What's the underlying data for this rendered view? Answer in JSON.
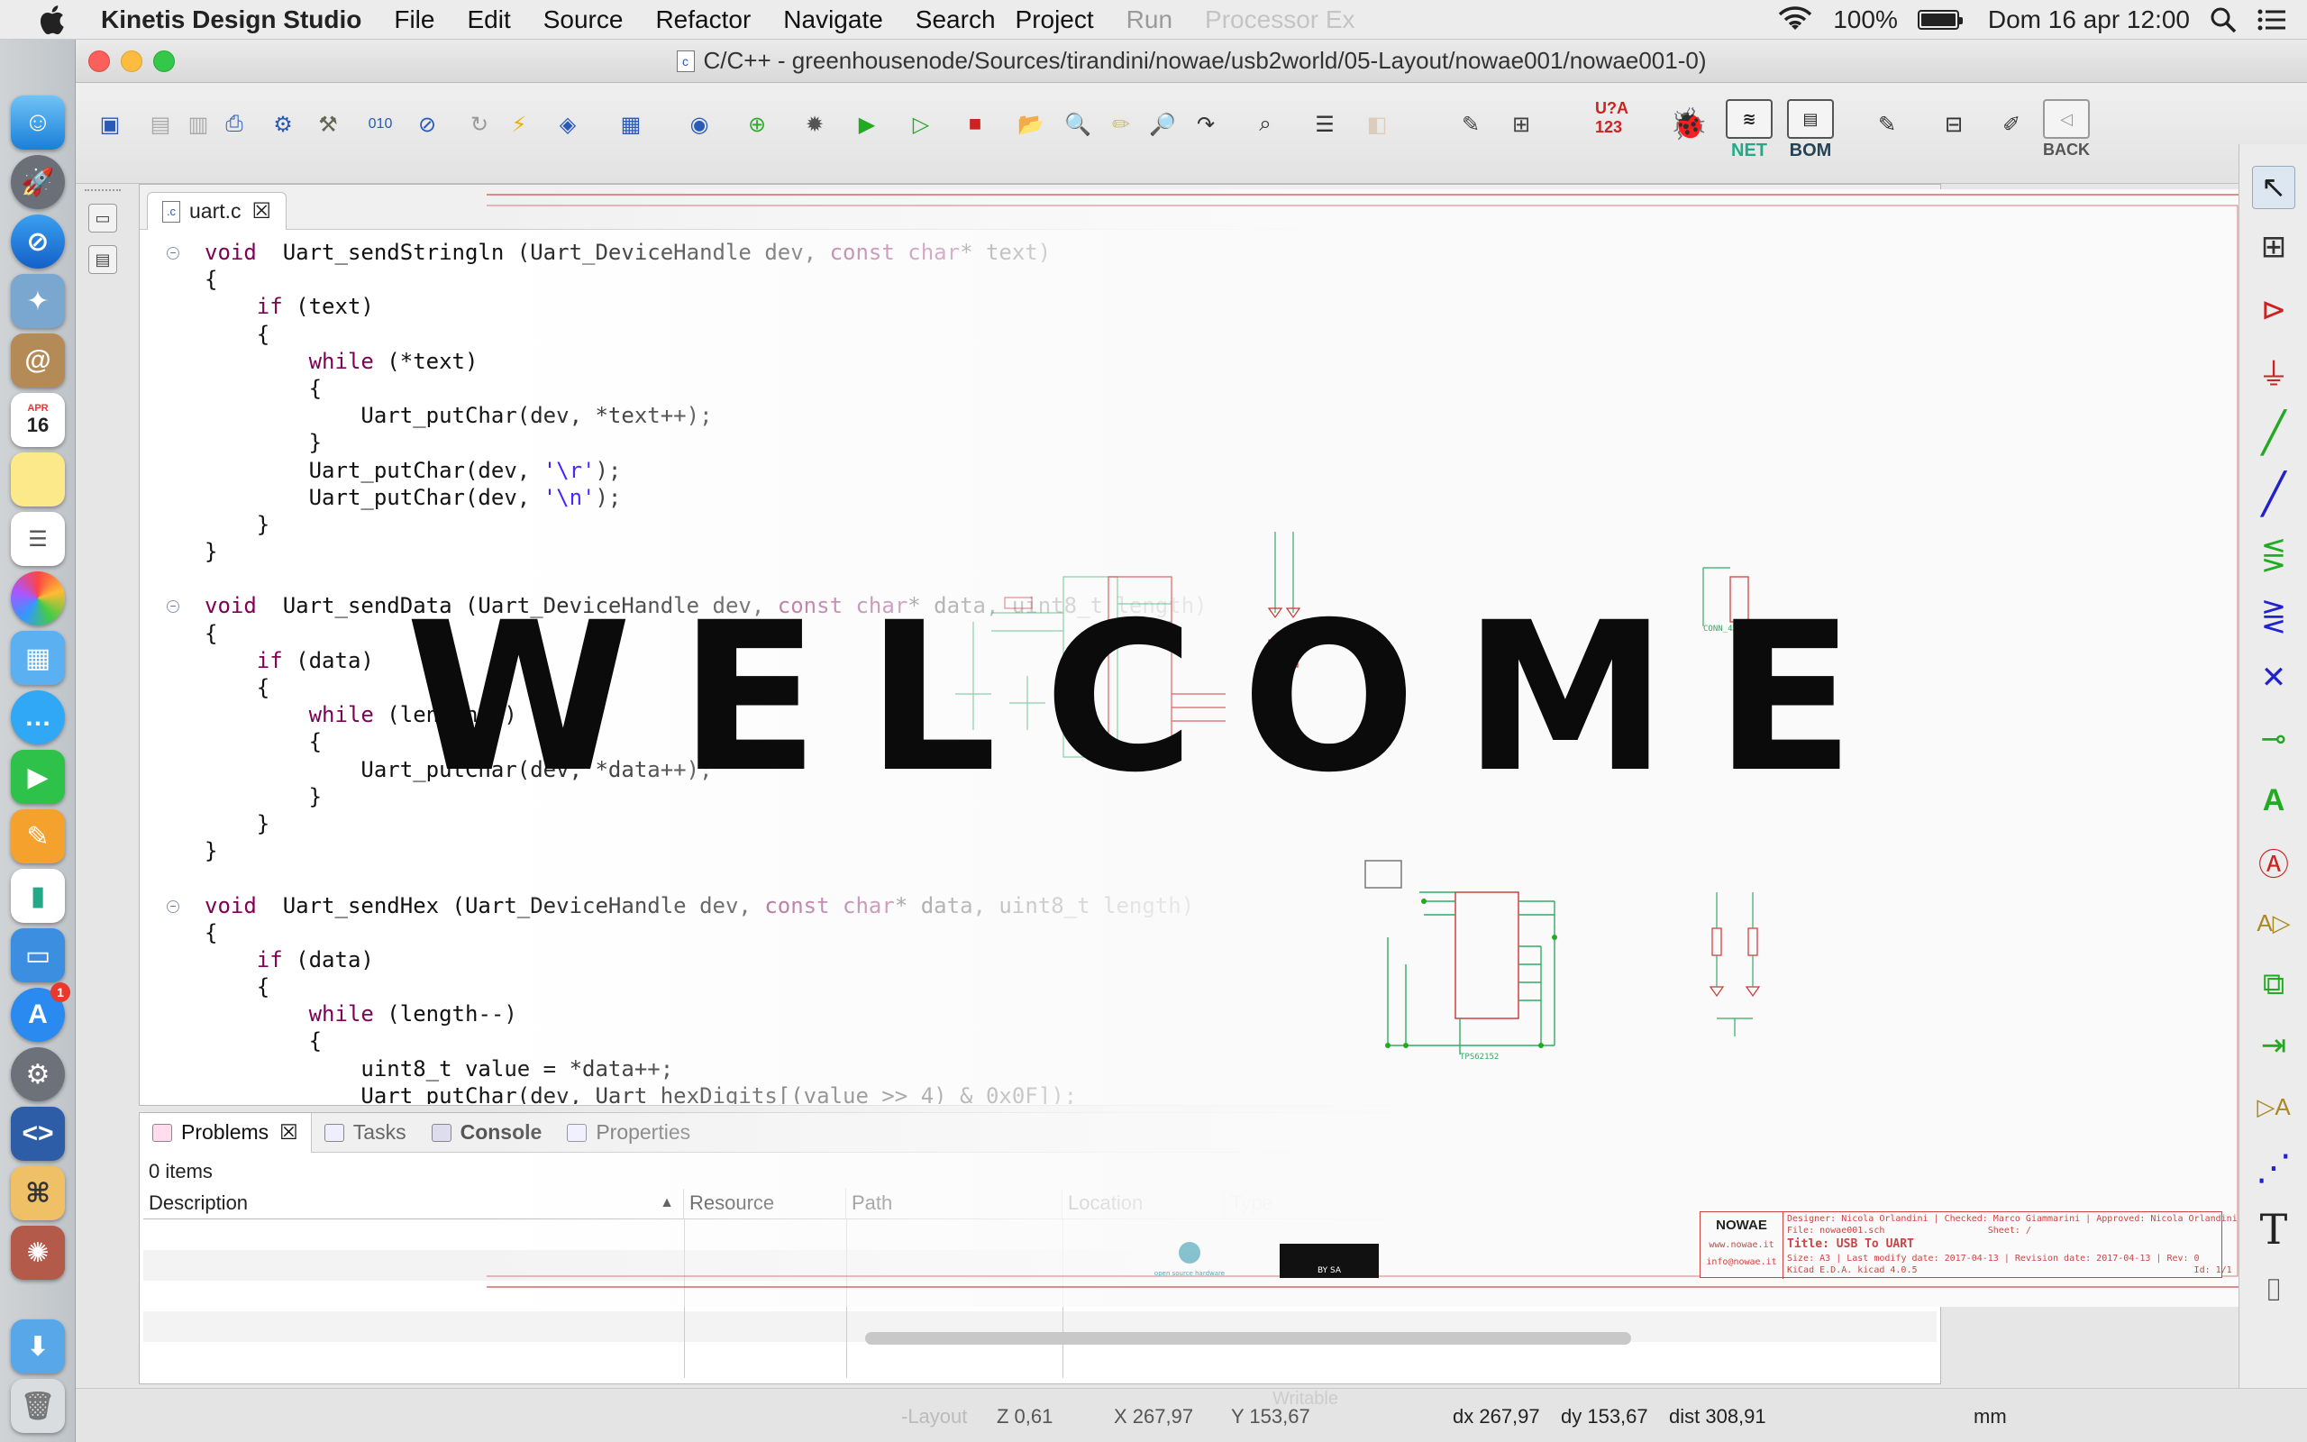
{
  "menubar": {
    "app_name": "Kinetis Design Studio",
    "items": [
      "File",
      "Edit",
      "Source",
      "Refactor",
      "Navigate",
      "Search",
      "Project",
      "Run",
      "Processor Ex"
    ],
    "battery_percent": "100%",
    "battery_level": 1.0,
    "datetime": "Dom 16 apr  12:00"
  },
  "window": {
    "title": "C/C++ - greenhousenode/Sources/tirandini/nowae/usb2world/05-Layout/nowae001/nowae001-0)"
  },
  "dock": {
    "calendar_month": "APR",
    "calendar_day": "16",
    "appstore_badge": "1"
  },
  "toolbar": {
    "big_labels": [
      "U?A 123",
      "NET",
      "BOM",
      "BACK"
    ]
  },
  "editor": {
    "tab_label": "uart.c",
    "file_icon": ".c",
    "lines": [
      {
        "fold": true,
        "parts": [
          [
            "kw",
            "void"
          ],
          [
            "",
            "  Uart_sendStringln (Uart_DeviceHandle dev, "
          ],
          [
            "kw",
            "const"
          ],
          [
            "",
            " "
          ],
          [
            "kw",
            "char"
          ],
          [
            "",
            "* text)"
          ]
        ]
      },
      {
        "parts": [
          [
            "",
            "{"
          ]
        ]
      },
      {
        "parts": [
          [
            "",
            "    "
          ],
          [
            "kw",
            "if"
          ],
          [
            "",
            " (text)"
          ]
        ]
      },
      {
        "parts": [
          [
            "",
            "    {"
          ]
        ]
      },
      {
        "parts": [
          [
            "",
            "        "
          ],
          [
            "kw",
            "while"
          ],
          [
            "",
            " (*text)"
          ]
        ]
      },
      {
        "parts": [
          [
            "",
            "        {"
          ]
        ]
      },
      {
        "parts": [
          [
            "",
            "            Uart_putChar(dev, *text++);"
          ]
        ]
      },
      {
        "parts": [
          [
            "",
            "        }"
          ]
        ]
      },
      {
        "parts": [
          [
            "",
            "        Uart_putChar(dev, "
          ],
          [
            "str",
            "'\\r'"
          ],
          [
            "",
            ");"
          ]
        ]
      },
      {
        "parts": [
          [
            "",
            "        Uart_putChar(dev, "
          ],
          [
            "str",
            "'\\n'"
          ],
          [
            "",
            ");"
          ]
        ]
      },
      {
        "parts": [
          [
            "",
            "    }"
          ]
        ]
      },
      {
        "parts": [
          [
            "",
            "}"
          ]
        ]
      },
      {
        "parts": [
          [
            "",
            ""
          ]
        ]
      },
      {
        "fold": true,
        "parts": [
          [
            "kw",
            "void"
          ],
          [
            "",
            "  Uart_sendData (Uart_DeviceHandle dev, "
          ],
          [
            "kw",
            "const"
          ],
          [
            "",
            " "
          ],
          [
            "kw",
            "char"
          ],
          [
            "",
            "* data, uint8_t length)"
          ]
        ]
      },
      {
        "parts": [
          [
            "",
            "{"
          ]
        ]
      },
      {
        "parts": [
          [
            "",
            "    "
          ],
          [
            "kw",
            "if"
          ],
          [
            "",
            " (data)"
          ]
        ]
      },
      {
        "parts": [
          [
            "",
            "    {"
          ]
        ]
      },
      {
        "parts": [
          [
            "",
            "        "
          ],
          [
            "kw",
            "while"
          ],
          [
            "",
            " (length--)"
          ]
        ]
      },
      {
        "parts": [
          [
            "",
            "        {"
          ]
        ]
      },
      {
        "parts": [
          [
            "",
            "            Uart_putChar(dev, *data++);"
          ]
        ]
      },
      {
        "parts": [
          [
            "",
            "        }"
          ]
        ]
      },
      {
        "parts": [
          [
            "",
            "    }"
          ]
        ]
      },
      {
        "parts": [
          [
            "",
            "}"
          ]
        ]
      },
      {
        "parts": [
          [
            "",
            ""
          ]
        ]
      },
      {
        "fold": true,
        "parts": [
          [
            "kw",
            "void"
          ],
          [
            "",
            "  Uart_sendHex (Uart_DeviceHandle dev, "
          ],
          [
            "kw",
            "const"
          ],
          [
            "",
            " "
          ],
          [
            "kw",
            "char"
          ],
          [
            "",
            "* data, uint8_t length)"
          ]
        ]
      },
      {
        "parts": [
          [
            "",
            "{"
          ]
        ]
      },
      {
        "parts": [
          [
            "",
            "    "
          ],
          [
            "kw",
            "if"
          ],
          [
            "",
            " (data)"
          ]
        ]
      },
      {
        "parts": [
          [
            "",
            "    {"
          ]
        ]
      },
      {
        "parts": [
          [
            "",
            "        "
          ],
          [
            "kw",
            "while"
          ],
          [
            "",
            " (length--)"
          ]
        ]
      },
      {
        "parts": [
          [
            "",
            "        {"
          ]
        ]
      },
      {
        "parts": [
          [
            "",
            "            uint8_t value = *data++;"
          ]
        ]
      },
      {
        "parts": [
          [
            "",
            "            Uart_putChar(dev, Uart_hexDigits[(value >> 4) & 0x0F]);"
          ]
        ]
      }
    ]
  },
  "panel": {
    "tabs": [
      "Problems",
      "Tasks",
      "Console",
      "Properties"
    ],
    "items_count": "0 items",
    "columns": [
      "Description",
      "Resource",
      "Path",
      "Location",
      "Type"
    ]
  },
  "overlay": {
    "welcome": "WELCOME"
  },
  "schematic": {
    "company": "NOWAE",
    "website": "www.nowae.it",
    "email": "info@nowae.it",
    "designer": "Designer: Nicola Orlandini",
    "checked": "Checked: Marco Giammarini",
    "approved": "Approved: Nicola Orlandini",
    "file": "File: nowae001.sch",
    "sheet": "Sheet: /",
    "title": "Title: USB To UART",
    "size": "Size: A3",
    "last_modify": "Last modify date: 2017-04-13",
    "revision_date": "Revision date: 2017-04-13",
    "rev": "Rev: 0",
    "kicad": "KiCad E.D.A.  kicad 4.0.5",
    "id": "Id: 1/1",
    "chip": "TPS62152",
    "conn": "CONN_4X1",
    "license": "BY SA",
    "oshw": "open source hardware"
  },
  "statusbar": {
    "layout": "-Layout",
    "zoom": "Z 0,61",
    "x": "X 267,97",
    "y": "Y 153,67",
    "writable": "Writable",
    "dx": "dx 267,97",
    "dy": "dy 153,67",
    "dist": "dist 308,91",
    "units": "mm"
  }
}
